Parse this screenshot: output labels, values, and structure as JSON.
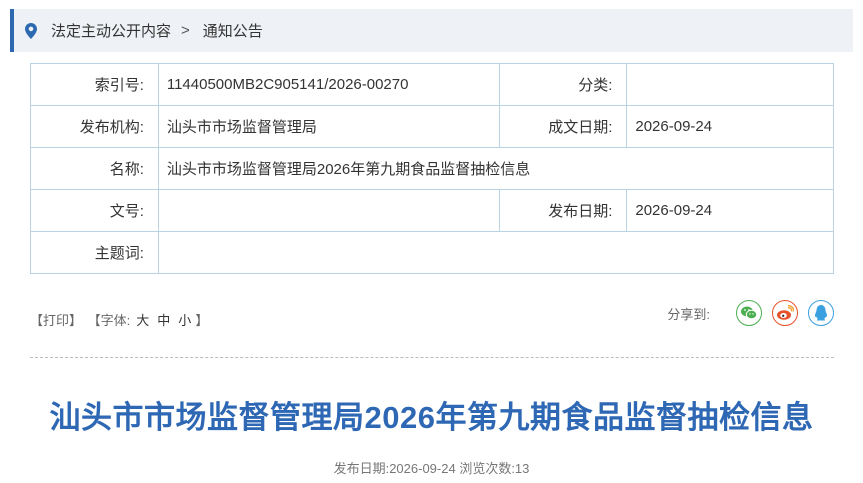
{
  "breadcrumb": {
    "items": [
      "法定主动公开内容",
      "通知公告"
    ],
    "separator": ">"
  },
  "meta": {
    "index_label": "索引号:",
    "index_value": "11440500MB2C905141/2026-00270",
    "category_label": "分类:",
    "category_value": "",
    "publisher_label": "发布机构:",
    "publisher_value": "汕头市市场监督管理局",
    "written_date_label": "成文日期:",
    "written_date_value": "2026-09-24",
    "name_label": "名称:",
    "name_value": "汕头市市场监督管理局2026年第九期食品监督抽检信息",
    "doc_no_label": "文号:",
    "doc_no_value": "",
    "publish_date_label": "发布日期:",
    "publish_date_value": "2026-09-24",
    "keywords_label": "主题词:",
    "keywords_value": ""
  },
  "tools": {
    "print": "【打印】",
    "font_open": "【字体:",
    "font_large": "大",
    "font_medium": "中",
    "font_small": "小",
    "font_close": "】",
    "share_label": "分享到:",
    "share_icons": [
      "wechat-icon",
      "weibo-icon",
      "qq-icon"
    ]
  },
  "article": {
    "title": "汕头市市场监督管理局2026年第九期食品监督抽检信息",
    "publish_info": "发布日期:2026-09-24  浏览次数:13"
  },
  "colors": {
    "accent": "#2d69b0",
    "title": "#2e68b4",
    "wechat": "#4caf50",
    "weibo": "#e6522c",
    "qq": "#3aa0e0"
  }
}
